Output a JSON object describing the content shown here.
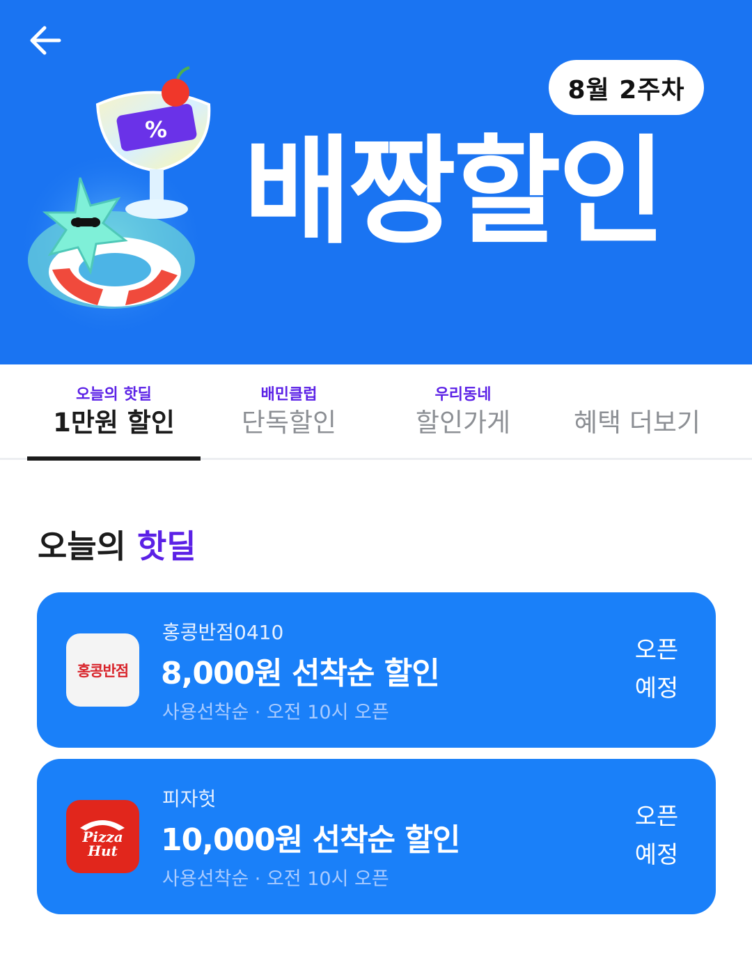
{
  "header": {
    "week_badge": "8월 2주차",
    "title": "배짱할인",
    "bg_color": "#1a74f2",
    "back_icon": "arrow-left-icon"
  },
  "tabs": [
    {
      "sub": "오늘의 핫딜",
      "label": "1만원 할인",
      "active": true
    },
    {
      "sub": "배민클럽",
      "label": "단독할인",
      "active": false
    },
    {
      "sub": "우리동네",
      "label": "할인가게",
      "active": false
    },
    {
      "sub": "",
      "label": "혜택 더보기",
      "active": false
    }
  ],
  "section": {
    "title_prefix": "오늘의 ",
    "title_accent": "핫딜",
    "accent_color": "#5b21e6"
  },
  "deals": [
    {
      "store": "홍콩반점0410",
      "logo_text": "홍콩반점",
      "amount": "8,000원 선착순 할인",
      "meta": "사용선착순 · 오전 10시 오픈",
      "status_line1": "오픈",
      "status_line2": "예정"
    },
    {
      "store": "피자헛",
      "logo_text": "Pizza Hut",
      "amount": "10,000원 선착순 할인",
      "meta": "사용선착순 · 오전 10시 오픈",
      "status_line1": "오픈",
      "status_line2": "예정"
    }
  ],
  "colors": {
    "card_bg": "#1a80f9",
    "hongkong_logo_red": "#d8232a",
    "pizzahut_red": "#e1261c"
  }
}
